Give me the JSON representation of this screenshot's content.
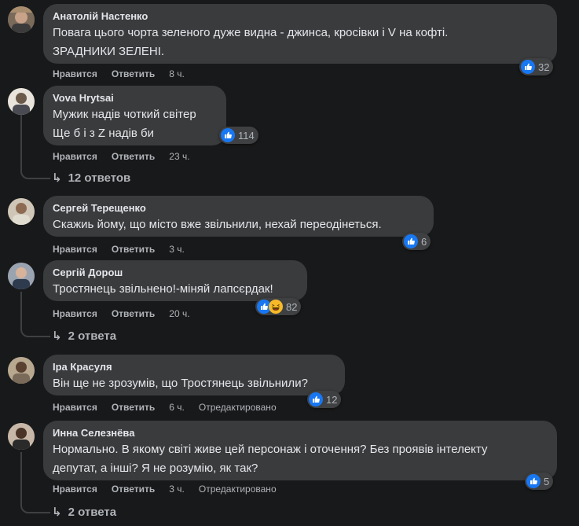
{
  "labels": {
    "like": "Нравится",
    "reply": "Ответить",
    "edited": "Отредактировано"
  },
  "comments": [
    {
      "author": "Анатолій Настенко",
      "lines": [
        "Повага цього чорта зеленого дуже видна - джинса, кросівки і V на кофті.",
        "ЗРАДНИКИ ЗЕЛЕНІ."
      ],
      "reactions": "32",
      "time": "8 ч."
    },
    {
      "author": "Vova Hrytsai",
      "lines": [
        "Мужик надів чоткий світер",
        "Ще б і з Z надів би"
      ],
      "reactions": "114",
      "time": "23 ч.",
      "replies": "12 ответов"
    },
    {
      "author": "Сергей Терещенко",
      "lines": [
        "Скажиь йому, що місто вже звільнили, нехай переодінеться."
      ],
      "reactions": "6",
      "time": "3 ч."
    },
    {
      "author": "Сергій Дорош",
      "lines": [
        "Тростянець звільнено!-міняй лапсєрдак!"
      ],
      "reactions": "82",
      "time": "20 ч.",
      "replies": "2 ответа"
    },
    {
      "author": "Іра Красуля",
      "lines": [
        "Він ще не зрозумів, що Тростянець звільнили?"
      ],
      "reactions": "12",
      "time": "6 ч.",
      "edited": true
    },
    {
      "author": "Инна Селезнёва",
      "lines": [
        "Нормально. В якому світі живе цей персонаж і оточення? Без проявів інтелекту",
        "депутат, а інші? Я не розумію, як так?"
      ],
      "reactions": "5",
      "time": "3 ч.",
      "edited": true,
      "replies": "2 ответа"
    }
  ],
  "colors": {
    "background": "#18191a",
    "bubble": "#3a3b3c",
    "like_blue": "#1877f2",
    "haha_yellow": "#f7b928",
    "muted_text": "#b0b3b8"
  },
  "icons": {
    "like": "thumbs-up-icon",
    "haha": "laughing-face-icon",
    "reply_arrow": "reply-arrow-icon"
  }
}
